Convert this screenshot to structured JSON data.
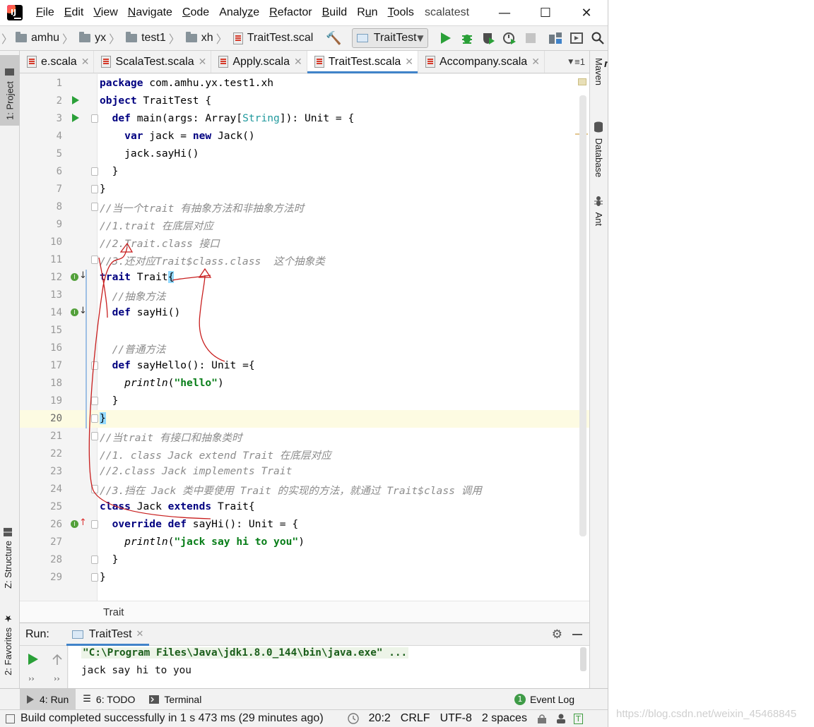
{
  "window": {
    "project_title": "scalatest",
    "menu": [
      {
        "pre": "",
        "u": "F",
        "post": "ile"
      },
      {
        "pre": "",
        "u": "E",
        "post": "dit"
      },
      {
        "pre": "",
        "u": "V",
        "post": "iew"
      },
      {
        "pre": "",
        "u": "N",
        "post": "avigate"
      },
      {
        "pre": "",
        "u": "C",
        "post": "ode"
      },
      {
        "pre": "Analy",
        "u": "z",
        "post": "e"
      },
      {
        "pre": "",
        "u": "R",
        "post": "efactor"
      },
      {
        "pre": "",
        "u": "B",
        "post": "uild"
      },
      {
        "pre": "R",
        "u": "u",
        "post": "n"
      },
      {
        "pre": "",
        "u": "T",
        "post": "ools"
      }
    ],
    "minimize": "—",
    "maximize": "☐",
    "close": "✕"
  },
  "navbar": {
    "crumbs": [
      "amhu",
      "yx",
      "test1",
      "xh"
    ],
    "file": "TraitTest.scal",
    "run_config": "TraitTest"
  },
  "stripes": {
    "left": [
      "1: Project",
      "Z: Structure",
      "2: Favorites"
    ],
    "right": [
      "Maven",
      "Database",
      "Ant"
    ]
  },
  "tabs": [
    {
      "label": "e.scala",
      "active": false
    },
    {
      "label": "ScalaTest.scala",
      "active": false
    },
    {
      "label": "Apply.scala",
      "active": false
    },
    {
      "label": "TraitTest.scala",
      "active": true
    },
    {
      "label": "Accompany.scala",
      "active": false
    }
  ],
  "tabs_overflow": "≡1",
  "editor": {
    "current_line": 20,
    "lines": [
      {
        "n": 1,
        "html": "<span class='kw'>package</span> com.amhu.yx.test1.xh"
      },
      {
        "n": 2,
        "html": "<span class='kw'>object</span> TraitTest {",
        "run": true
      },
      {
        "n": 3,
        "html": "  <span class='kw'>def</span> main(args: Array[<span class='typ'>String</span>]): Unit = {",
        "run": true,
        "fold": true
      },
      {
        "n": 4,
        "html": "    <span class='kw'>var</span> jack = <span class='kw'>new</span> Jack()"
      },
      {
        "n": 5,
        "html": "    jack.sayHi()"
      },
      {
        "n": 6,
        "html": "  }",
        "fold": true
      },
      {
        "n": 7,
        "html": "}",
        "fold": true
      },
      {
        "n": 8,
        "html": "<span class='cm'>//当一个trait 有抽象方法和非抽象方法时</span>",
        "fold": true
      },
      {
        "n": 9,
        "html": "<span class='cm'>//1.trait 在底层对应</span>"
      },
      {
        "n": 10,
        "html": "<span class='cm'>//2.Trait.class 接口</span>"
      },
      {
        "n": 11,
        "html": "<span class='cm'>//3.还对应Trait$class.class  这个抽象类</span>",
        "fold": true
      },
      {
        "n": 12,
        "html": "<span class='kw'>trait</span> Trait<span class='match'>{</span>",
        "impl": "↓"
      },
      {
        "n": 13,
        "html": "  <span class='cm'>//抽象方法</span>"
      },
      {
        "n": 14,
        "html": "  <span class='kw'>def</span> sayHi()",
        "impl": "↓"
      },
      {
        "n": 15,
        "html": ""
      },
      {
        "n": 16,
        "html": "  <span class='cm'>//普通方法</span>"
      },
      {
        "n": 17,
        "html": "  <span class='kw'>def</span> sayHello(): Unit ={",
        "fold": true
      },
      {
        "n": 18,
        "html": "    <span class='fn'>println</span>(<span class='str'>\"hello\"</span>)"
      },
      {
        "n": 19,
        "html": "  }",
        "fold": true
      },
      {
        "n": 20,
        "html": "<span class='match'>}</span>",
        "fold": true
      },
      {
        "n": 21,
        "html": "<span class='cm'>//当trait 有接口和抽象类时</span>",
        "fold": true
      },
      {
        "n": 22,
        "html": "<span class='cm'>//1. class Jack extend Trait 在底层对应</span>"
      },
      {
        "n": 23,
        "html": "<span class='cm'>//2.class Jack implements Trait</span>"
      },
      {
        "n": 24,
        "html": "<span class='cm'>//3.挡在 Jack 类中要使用 Trait 的实现的方法，就通过 Trait$class 调用</span>",
        "fold": true
      },
      {
        "n": 25,
        "html": "<span class='kw'>class</span> Jack <span class='kw'>extends</span> Trait{"
      },
      {
        "n": 26,
        "html": "  <span class='kw'>override def</span> sayHi(): Unit = {",
        "impl": "↑",
        "fold": true
      },
      {
        "n": 27,
        "html": "    <span class='fn'>println</span>(<span class='str'>\"jack say hi to you\"</span>)"
      },
      {
        "n": 28,
        "html": "  }",
        "fold": true
      },
      {
        "n": 29,
        "html": "}",
        "fold": true
      }
    ]
  },
  "breadcrumb": "Trait",
  "run_panel": {
    "title": "Run:",
    "tab": "TraitTest",
    "command": "\"C:\\Program Files\\Java\\jdk1.8.0_144\\bin\\java.exe\" ...",
    "output": "jack say hi to you"
  },
  "toolwindows": {
    "run": "4: Run",
    "todo": "6: TODO",
    "terminal": "Terminal",
    "event_log": "Event Log"
  },
  "status": {
    "message": "Build completed successfully in 1 s 473 ms (29 minutes ago)",
    "position": "20:2",
    "line_sep": "CRLF",
    "encoding": "UTF-8",
    "indent": "2 spaces"
  },
  "watermark": "https://blog.csdn.net/weixin_45468845"
}
